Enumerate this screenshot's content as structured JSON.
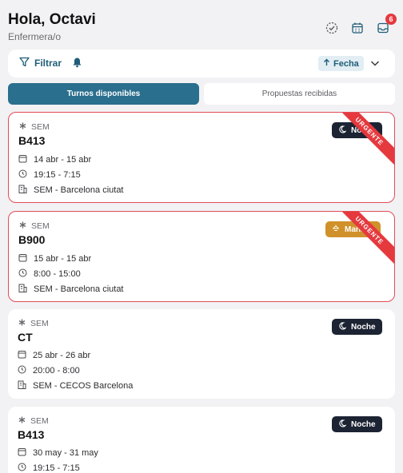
{
  "header": {
    "greeting": "Hola, Octavi",
    "role": "Enfermera/o",
    "notification_count": "6"
  },
  "filter_bar": {
    "filter_label": "Filtrar",
    "sort_label": "Fecha"
  },
  "tabs": [
    {
      "label": "Turnos disponibles",
      "active": true
    },
    {
      "label": "Propuestas recibidas",
      "active": false
    }
  ],
  "cards": [
    {
      "org": "SEM",
      "code": "B413",
      "dates": "14 abr - 15 abr",
      "time": "19:15 - 7:15",
      "place": "SEM - Barcelona ciutat",
      "shift": "Noche",
      "shift_type": "night",
      "urgent": "URGENTE"
    },
    {
      "org": "SEM",
      "code": "B900",
      "dates": "15 abr - 15 abr",
      "time": "8:00 - 15:00",
      "place": "SEM - Barcelona ciutat",
      "shift": "Mañana",
      "shift_type": "morning",
      "urgent": "URGENTE"
    },
    {
      "org": "SEM",
      "code": "CT",
      "dates": "25 abr - 26 abr",
      "time": "20:00 - 8:00",
      "place": "SEM - CECOS Barcelona",
      "shift": "Noche",
      "shift_type": "night"
    },
    {
      "org": "SEM",
      "code": "B413",
      "dates": "30 may - 31 may",
      "time": "19:15 - 7:15",
      "place": "",
      "shift": "Noche",
      "shift_type": "night"
    }
  ],
  "colors": {
    "primary": "#2a6f8d",
    "urgent": "#e5393e",
    "night": "#1c2333",
    "morning": "#d0912a"
  }
}
